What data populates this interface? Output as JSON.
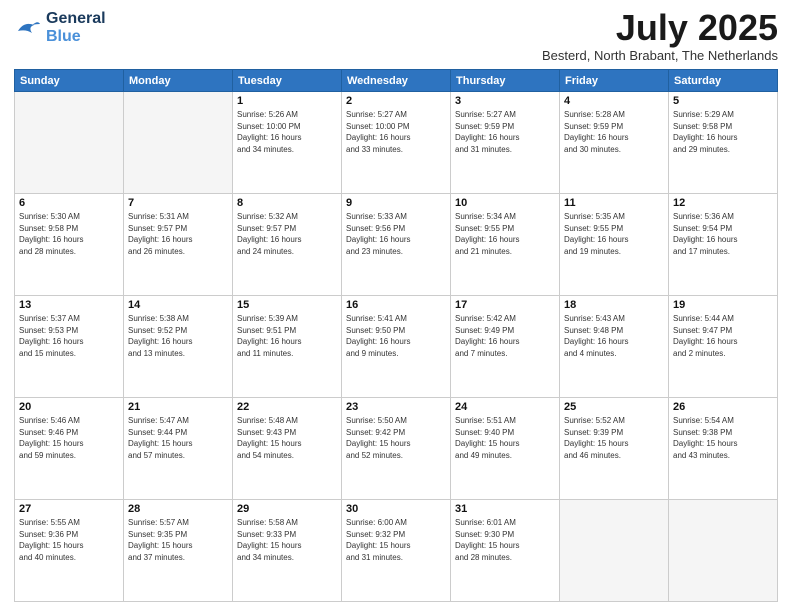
{
  "logo": {
    "line1": "General",
    "line2": "Blue"
  },
  "title": "July 2025",
  "subtitle": "Besterd, North Brabant, The Netherlands",
  "days_of_week": [
    "Sunday",
    "Monday",
    "Tuesday",
    "Wednesday",
    "Thursday",
    "Friday",
    "Saturday"
  ],
  "weeks": [
    [
      {
        "day": "",
        "info": ""
      },
      {
        "day": "",
        "info": ""
      },
      {
        "day": "1",
        "info": "Sunrise: 5:26 AM\nSunset: 10:00 PM\nDaylight: 16 hours\nand 34 minutes."
      },
      {
        "day": "2",
        "info": "Sunrise: 5:27 AM\nSunset: 10:00 PM\nDaylight: 16 hours\nand 33 minutes."
      },
      {
        "day": "3",
        "info": "Sunrise: 5:27 AM\nSunset: 9:59 PM\nDaylight: 16 hours\nand 31 minutes."
      },
      {
        "day": "4",
        "info": "Sunrise: 5:28 AM\nSunset: 9:59 PM\nDaylight: 16 hours\nand 30 minutes."
      },
      {
        "day": "5",
        "info": "Sunrise: 5:29 AM\nSunset: 9:58 PM\nDaylight: 16 hours\nand 29 minutes."
      }
    ],
    [
      {
        "day": "6",
        "info": "Sunrise: 5:30 AM\nSunset: 9:58 PM\nDaylight: 16 hours\nand 28 minutes."
      },
      {
        "day": "7",
        "info": "Sunrise: 5:31 AM\nSunset: 9:57 PM\nDaylight: 16 hours\nand 26 minutes."
      },
      {
        "day": "8",
        "info": "Sunrise: 5:32 AM\nSunset: 9:57 PM\nDaylight: 16 hours\nand 24 minutes."
      },
      {
        "day": "9",
        "info": "Sunrise: 5:33 AM\nSunset: 9:56 PM\nDaylight: 16 hours\nand 23 minutes."
      },
      {
        "day": "10",
        "info": "Sunrise: 5:34 AM\nSunset: 9:55 PM\nDaylight: 16 hours\nand 21 minutes."
      },
      {
        "day": "11",
        "info": "Sunrise: 5:35 AM\nSunset: 9:55 PM\nDaylight: 16 hours\nand 19 minutes."
      },
      {
        "day": "12",
        "info": "Sunrise: 5:36 AM\nSunset: 9:54 PM\nDaylight: 16 hours\nand 17 minutes."
      }
    ],
    [
      {
        "day": "13",
        "info": "Sunrise: 5:37 AM\nSunset: 9:53 PM\nDaylight: 16 hours\nand 15 minutes."
      },
      {
        "day": "14",
        "info": "Sunrise: 5:38 AM\nSunset: 9:52 PM\nDaylight: 16 hours\nand 13 minutes."
      },
      {
        "day": "15",
        "info": "Sunrise: 5:39 AM\nSunset: 9:51 PM\nDaylight: 16 hours\nand 11 minutes."
      },
      {
        "day": "16",
        "info": "Sunrise: 5:41 AM\nSunset: 9:50 PM\nDaylight: 16 hours\nand 9 minutes."
      },
      {
        "day": "17",
        "info": "Sunrise: 5:42 AM\nSunset: 9:49 PM\nDaylight: 16 hours\nand 7 minutes."
      },
      {
        "day": "18",
        "info": "Sunrise: 5:43 AM\nSunset: 9:48 PM\nDaylight: 16 hours\nand 4 minutes."
      },
      {
        "day": "19",
        "info": "Sunrise: 5:44 AM\nSunset: 9:47 PM\nDaylight: 16 hours\nand 2 minutes."
      }
    ],
    [
      {
        "day": "20",
        "info": "Sunrise: 5:46 AM\nSunset: 9:46 PM\nDaylight: 15 hours\nand 59 minutes."
      },
      {
        "day": "21",
        "info": "Sunrise: 5:47 AM\nSunset: 9:44 PM\nDaylight: 15 hours\nand 57 minutes."
      },
      {
        "day": "22",
        "info": "Sunrise: 5:48 AM\nSunset: 9:43 PM\nDaylight: 15 hours\nand 54 minutes."
      },
      {
        "day": "23",
        "info": "Sunrise: 5:50 AM\nSunset: 9:42 PM\nDaylight: 15 hours\nand 52 minutes."
      },
      {
        "day": "24",
        "info": "Sunrise: 5:51 AM\nSunset: 9:40 PM\nDaylight: 15 hours\nand 49 minutes."
      },
      {
        "day": "25",
        "info": "Sunrise: 5:52 AM\nSunset: 9:39 PM\nDaylight: 15 hours\nand 46 minutes."
      },
      {
        "day": "26",
        "info": "Sunrise: 5:54 AM\nSunset: 9:38 PM\nDaylight: 15 hours\nand 43 minutes."
      }
    ],
    [
      {
        "day": "27",
        "info": "Sunrise: 5:55 AM\nSunset: 9:36 PM\nDaylight: 15 hours\nand 40 minutes."
      },
      {
        "day": "28",
        "info": "Sunrise: 5:57 AM\nSunset: 9:35 PM\nDaylight: 15 hours\nand 37 minutes."
      },
      {
        "day": "29",
        "info": "Sunrise: 5:58 AM\nSunset: 9:33 PM\nDaylight: 15 hours\nand 34 minutes."
      },
      {
        "day": "30",
        "info": "Sunrise: 6:00 AM\nSunset: 9:32 PM\nDaylight: 15 hours\nand 31 minutes."
      },
      {
        "day": "31",
        "info": "Sunrise: 6:01 AM\nSunset: 9:30 PM\nDaylight: 15 hours\nand 28 minutes."
      },
      {
        "day": "",
        "info": ""
      },
      {
        "day": "",
        "info": ""
      }
    ]
  ]
}
